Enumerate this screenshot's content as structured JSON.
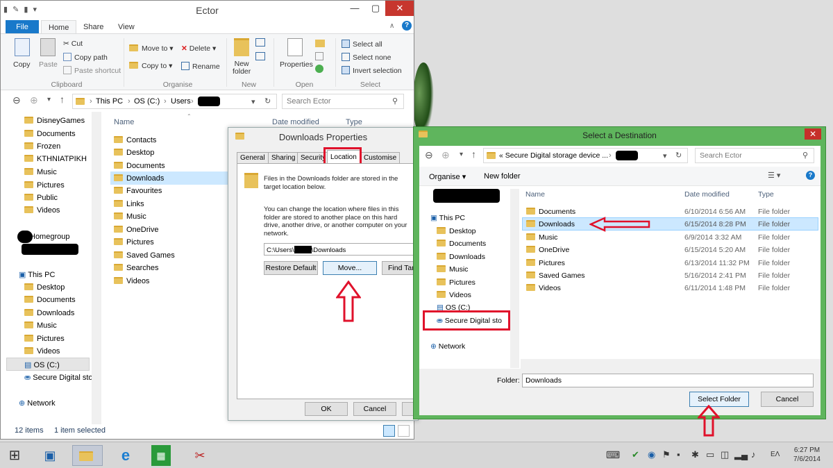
{
  "explorer": {
    "title": "Ector",
    "ribbon_tabs": [
      "File",
      "Home",
      "Share",
      "View"
    ],
    "clipboard": {
      "copy": "Copy",
      "paste": "Paste",
      "cut": "Cut",
      "copy_path": "Copy path",
      "paste_shortcut": "Paste shortcut",
      "group": "Clipboard"
    },
    "organise": {
      "move_to": "Move to ▾",
      "copy_to": "Copy to ▾",
      "delete": "Delete ▾",
      "rename": "Rename",
      "group": "Organise"
    },
    "new": {
      "new_folder_line1": "New",
      "new_folder_line2": "folder",
      "group": "New"
    },
    "open": {
      "properties": "Properties",
      "group": "Open"
    },
    "select": {
      "select_all": "Select all",
      "select_none": "Select none",
      "invert": "Invert selection",
      "group": "Select"
    },
    "breadcrumb": [
      "This PC",
      "OS (C:)",
      "Users"
    ],
    "search_placeholder": "Search Ector",
    "nav_top": [
      "DisneyGames",
      "Documents",
      "Frozen",
      "ΚΤΗΝΙΑΤΡΙΚΗ",
      "Music",
      "Pictures",
      "Public",
      "Videos"
    ],
    "homegroup": "Homegroup",
    "this_pc": "This PC",
    "nav_pc": [
      "Desktop",
      "Documents",
      "Downloads",
      "Music",
      "Pictures",
      "Videos",
      "OS (C:)",
      "Secure Digital sto"
    ],
    "network": "Network",
    "columns": {
      "name": "Name",
      "date": "Date modified",
      "type": "Type"
    },
    "files": [
      "Contacts",
      "Desktop",
      "Documents",
      "Downloads",
      "Favourites",
      "Links",
      "Music",
      "OneDrive",
      "Pictures",
      "Saved Games",
      "Searches",
      "Videos"
    ],
    "status_items": "12 items",
    "status_selected": "1 item selected"
  },
  "props": {
    "title": "Downloads Properties",
    "tabs": [
      "General",
      "Sharing",
      "Security",
      "Location",
      "Customise"
    ],
    "text1": "Files in the Downloads folder are stored in the target location below.",
    "text2": "You can change the location where files in this folder are stored to another place on this hard drive, another drive, or another computer on your network.",
    "path_prefix": "C:\\Users\\",
    "path_suffix": "\\Downloads",
    "restore": "Restore Default",
    "move": "Move...",
    "find": "Find Target...",
    "ok": "OK",
    "cancel": "Cancel"
  },
  "dest": {
    "title": "Select a Destination",
    "breadcrumb": "«  Secure Digital storage device ...",
    "search_placeholder": "Search Ector",
    "organise": "Organise ▾",
    "new_folder": "New folder",
    "this_pc": "This PC",
    "nav": [
      "Desktop",
      "Documents",
      "Downloads",
      "Music",
      "Pictures",
      "Videos",
      "OS (C:)",
      "Secure Digital sto"
    ],
    "network": "Network",
    "columns": {
      "name": "Name",
      "date": "Date modified",
      "type": "Type"
    },
    "rows": [
      {
        "name": "Documents",
        "date": "6/10/2014 6:56 AM",
        "type": "File folder"
      },
      {
        "name": "Downloads",
        "date": "6/15/2014 8:28 PM",
        "type": "File folder"
      },
      {
        "name": "Music",
        "date": "6/9/2014 3:32 AM",
        "type": "File folder"
      },
      {
        "name": "OneDrive",
        "date": "6/15/2014 5:20 AM",
        "type": "File folder"
      },
      {
        "name": "Pictures",
        "date": "6/13/2014 11:32 PM",
        "type": "File folder"
      },
      {
        "name": "Saved Games",
        "date": "5/16/2014 2:41 PM",
        "type": "File folder"
      },
      {
        "name": "Videos",
        "date": "6/11/2014 1:48 PM",
        "type": "File folder"
      }
    ],
    "folder_label": "Folder:",
    "folder_value": "Downloads",
    "select_folder": "Select Folder",
    "cancel": "Cancel"
  },
  "taskbar": {
    "lang": "EΛ",
    "time": "6:27 PM",
    "date": "7/6/2014"
  },
  "colors": {
    "accent": "#1979ca",
    "highlight_red": "#e0112b",
    "dialog_green": "#5fb55d",
    "selection": "#cce8ff"
  }
}
